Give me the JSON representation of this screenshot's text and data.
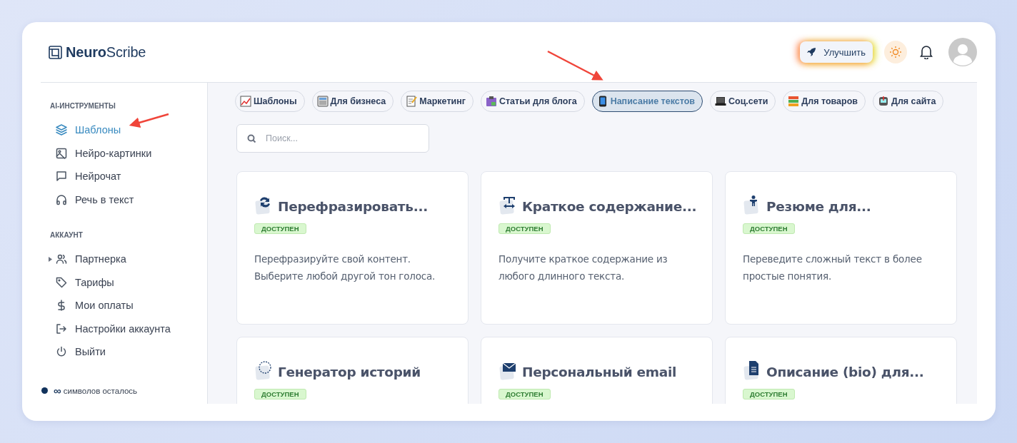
{
  "brand": {
    "name": "**Neuro**Scribe"
  },
  "header": {
    "upgrade_button": "Улучшить"
  },
  "sidebar": {
    "sections": [
      {
        "title": "AI-ИНСТРУМЕНТЫ",
        "items": [
          {
            "label": "Шаблоны",
            "selected": true
          },
          {
            "label": "Нейро-картинки",
            "selected": false
          },
          {
            "label": "Нейрочат",
            "selected": false
          },
          {
            "label": "Речь в текст",
            "selected": false
          }
        ]
      },
      {
        "title": "АККАУНТ",
        "items": [
          {
            "label": "Партнерка",
            "selected": false,
            "expanded": false
          },
          {
            "label": "Тарифы",
            "selected": false
          },
          {
            "label": "Мои оплаты",
            "selected": false
          },
          {
            "label": "Настройки аккаунта",
            "selected": false
          },
          {
            "label": "Выйти",
            "selected": false
          }
        ]
      }
    ],
    "footer": {
      "symbol": "∞",
      "text": "символов осталось"
    }
  },
  "categories": [
    {
      "label": "Шаблоны",
      "selected": false
    },
    {
      "label": "Для бизнеса",
      "selected": false
    },
    {
      "label": "Маркетинг",
      "selected": false
    },
    {
      "label": "Статьи для блога",
      "selected": false
    },
    {
      "label": "Написание текстов",
      "selected": true
    },
    {
      "label": "Соц.сети",
      "selected": false
    },
    {
      "label": "Для товаров",
      "selected": false
    },
    {
      "label": "Для сайта",
      "selected": false
    }
  ],
  "search": {
    "placeholder": "Поиск..."
  },
  "templates": [
    {
      "title": "Перефразировать...",
      "status": "ДОСТУПЕН",
      "description": "Перефразируйте свой контент. Выберите любой другой тон голоса."
    },
    {
      "title": "Краткое содержание...",
      "status": "ДОСТУПЕН",
      "description": "Получите краткое содержание из любого длинного текста."
    },
    {
      "title": "Резюме для...",
      "status": "ДОСТУПЕН",
      "description": "Переведите сложный текст в более простые понятия."
    },
    {
      "title": "Генератор историй",
      "status": "ДОСТУПЕН"
    },
    {
      "title": "Персональный email",
      "status": "ДОСТУПЕН"
    },
    {
      "title": "Описание (bio) для...",
      "status": "ДОСТУПЕН"
    }
  ]
}
